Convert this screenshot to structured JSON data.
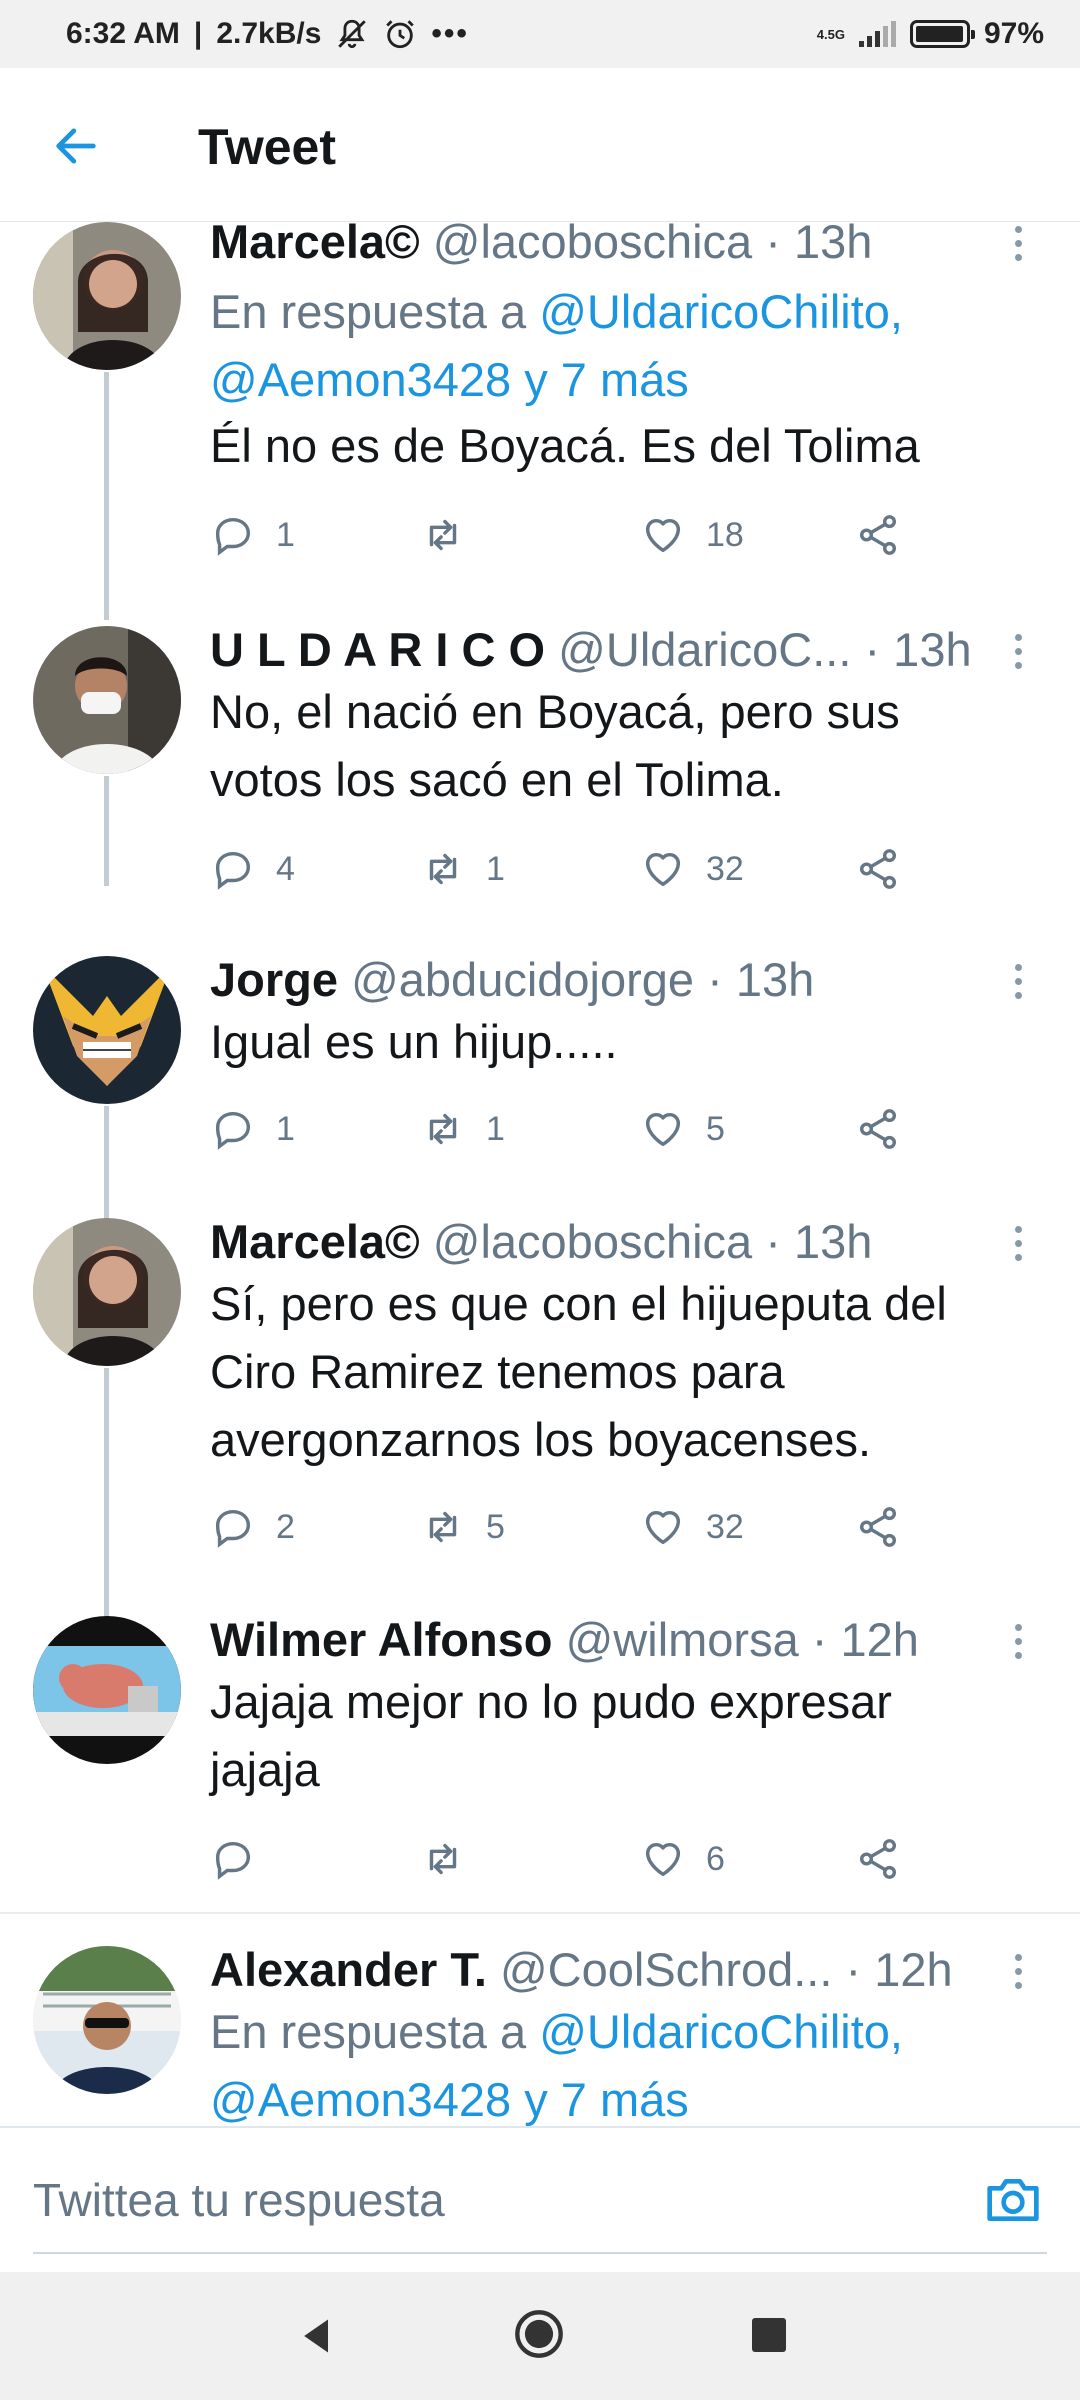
{
  "status_bar": {
    "time": "6:32 AM",
    "speed": "2.7kB/s",
    "network": "4.5G",
    "battery": "97%",
    "battery_level": 0.97,
    "icons": [
      "mute-icon",
      "alarm-icon",
      "more-dots-icon",
      "signal-icon",
      "battery-icon"
    ]
  },
  "header": {
    "title": "Tweet",
    "back_icon": "back-arrow-icon"
  },
  "tweets": [
    {
      "name": "Marcela©",
      "handle": "@lacoboschica",
      "time": "· 13h",
      "reply_prefix": "En respuesta a ",
      "reply_line1": "@UldaricoChilito,",
      "reply_line2": "@Aemon3428 y 7 más",
      "text": "Él no es de Boyacá. Es del Tolima",
      "replies": "1",
      "retweets": "",
      "likes": "18"
    },
    {
      "name": "U L D A R I C O",
      "handle": "@UldaricoC...",
      "time": "· 13h",
      "text_line1": "No, el nació en Boyacá, pero sus",
      "text_line2": "votos los sacó en el Tolima.",
      "replies": "4",
      "retweets": "1",
      "likes": "32"
    },
    {
      "name": "Jorge",
      "handle": "@abducidojorge",
      "time": "· 13h",
      "text": "Igual es un hijup.....",
      "replies": "1",
      "retweets": "1",
      "likes": "5"
    },
    {
      "name": "Marcela©",
      "handle": "@lacoboschica",
      "time": "· 13h",
      "text_line1": "Sí, pero es que con el hijueputa del",
      "text_line2": "Ciro Ramirez tenemos para",
      "text_line3": "avergonzarnos los boyacenses.",
      "replies": "2",
      "retweets": "5",
      "likes": "32"
    },
    {
      "name": "Wilmer Alfonso",
      "handle": "@wilmorsa",
      "time": "· 12h",
      "text_line1": "Jajaja mejor no lo pudo expresar",
      "text_line2": "jajaja",
      "replies": "",
      "retweets": "",
      "likes": "6"
    },
    {
      "name": "Alexander T.",
      "handle": "@CoolSchrod...",
      "time": "· 12h",
      "reply_prefix": "En respuesta a ",
      "reply_line1": "@UldaricoChilito,",
      "reply_line2": "@Aemon3428 y 7 más"
    }
  ],
  "reply_bar": {
    "placeholder": "Twittea tu respuesta",
    "camera_icon": "camera-icon"
  },
  "nav_bar": {
    "icons": [
      "nav-back-icon",
      "nav-home-icon",
      "nav-recent-icon"
    ]
  },
  "colors": {
    "accent": "#1b95e0",
    "secondary_text": "#657786",
    "primary_text": "#14171a"
  }
}
